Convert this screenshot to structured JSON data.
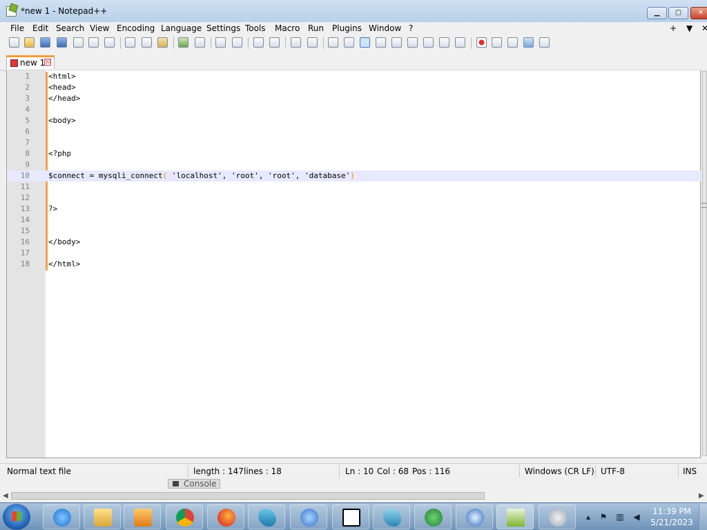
{
  "window": {
    "title": "*new 1 - Notepad++"
  },
  "menu": [
    "File",
    "Edit",
    "Search",
    "View",
    "Encoding",
    "Language",
    "Settings",
    "Tools",
    "Macro",
    "Run",
    "Plugins",
    "Window",
    "?"
  ],
  "menu_right": {
    "plus": "+",
    "arrow": "▼",
    "close": "✕"
  },
  "tab": {
    "label": "new 1",
    "close": "☒"
  },
  "editor": {
    "lines": [
      {
        "n": "1",
        "text": "<html>"
      },
      {
        "n": "2",
        "text": "<head>"
      },
      {
        "n": "3",
        "text": "</head>"
      },
      {
        "n": "4",
        "text": ""
      },
      {
        "n": "5",
        "text": "<body>"
      },
      {
        "n": "6",
        "text": ""
      },
      {
        "n": "7",
        "text": ""
      },
      {
        "n": "8",
        "text": "<?php"
      },
      {
        "n": "9",
        "text": ""
      },
      {
        "n": "10",
        "text": "$connect = mysqli_connect( 'localhost', 'root', 'root', 'database')"
      },
      {
        "n": "11",
        "text": ""
      },
      {
        "n": "12",
        "text": ""
      },
      {
        "n": "13",
        "text": "?>"
      },
      {
        "n": "14",
        "text": ""
      },
      {
        "n": "15",
        "text": ""
      },
      {
        "n": "16",
        "text": "</body>"
      },
      {
        "n": "17",
        "text": ""
      },
      {
        "n": "18",
        "text": "</html>"
      }
    ],
    "current_line": "10"
  },
  "status": {
    "file_type": "Normal text file",
    "length": "length : 147",
    "lines": "lines : 18",
    "ln": "Ln : 10",
    "col": "Col : 68",
    "pos": "Pos : 116",
    "eol": "Windows (CR LF)",
    "encoding": "UTF-8",
    "mode": "INS"
  },
  "console": {
    "label": "Console"
  },
  "taskbar": {
    "time": "11:39 PM",
    "date": "5/21/2023",
    "apps": [
      "internet-explorer",
      "file-explorer",
      "media-player",
      "chrome",
      "firefox",
      "mysql-workbench",
      "network-tool",
      "7-zip",
      "mysql-tool",
      "download-manager",
      "security-app",
      "notepad-plus-plus",
      "lambda-app"
    ]
  },
  "colors": {
    "accent_tab": "#f59d3b",
    "change_bar": "#f0a050",
    "current_line": "#e8e8ff"
  }
}
